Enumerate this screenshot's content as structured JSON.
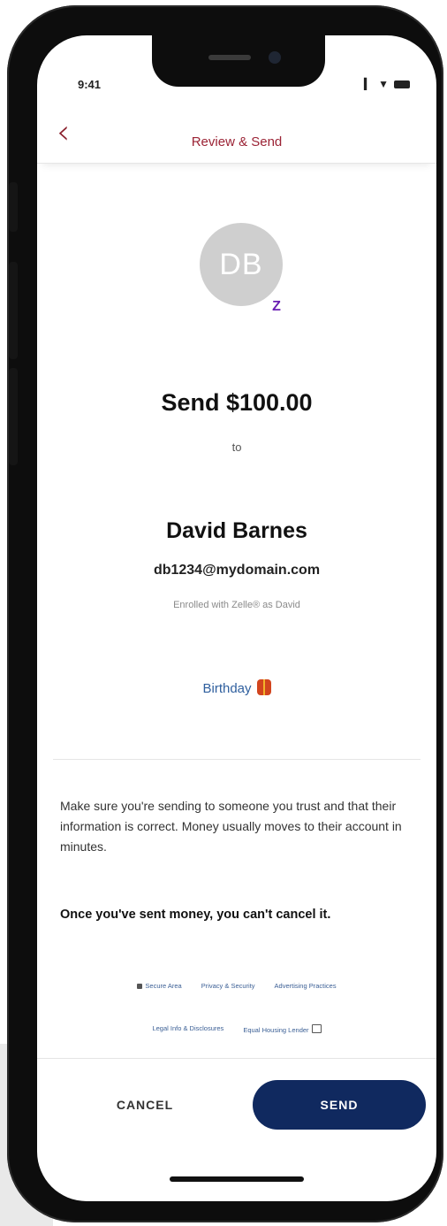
{
  "status_bar": {
    "time": "9:41",
    "signal": "▕▎",
    "wifi": "▼"
  },
  "header": {
    "title": "Review & Send",
    "back_icon": "‹"
  },
  "recipient": {
    "initials": "DB",
    "name": "David Barnes",
    "email": "db1234@mydomain.com",
    "enrolled_text": "Enrolled with Zelle® as David"
  },
  "zelle_badge": "Z",
  "transfer": {
    "amount_text": "Send $100.00",
    "to_label": "to"
  },
  "memo": {
    "text": "Birthday"
  },
  "disclaimer": "Make sure you're sending to someone you trust and that their information is correct. Money usually moves to their account in minutes.",
  "warning": "Once you've sent money, you can't cancel it.",
  "footer_links": {
    "row1": [
      "Secure Area",
      "Privacy & Security",
      "Advertising Practices"
    ],
    "row2": [
      "Legal Info & Disclosures",
      "Equal Housing Lender"
    ]
  },
  "actions": {
    "cancel_label": "CANCEL",
    "send_label": "SEND"
  },
  "colors": {
    "header_title": "#9b2335",
    "send_button": "#10295f",
    "link": "#3b5f95",
    "avatar": "#cfcfcf",
    "zelle_purple": "#6a1fb3"
  }
}
